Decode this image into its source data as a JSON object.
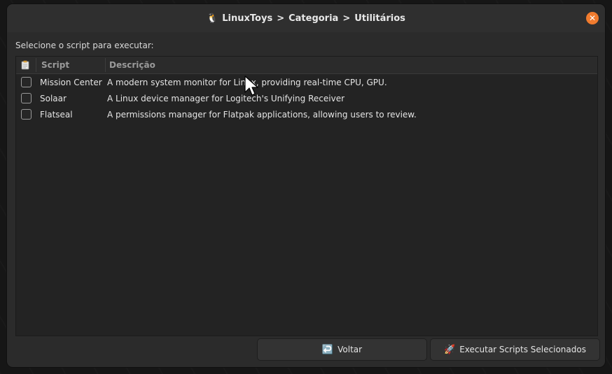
{
  "window": {
    "title_icon": "penguin-icon",
    "title_parts": [
      "LinuxToys",
      ">",
      "Categoria",
      ">",
      "Utilitários"
    ],
    "close_icon": "close-icon",
    "close_color": "#f07b2e"
  },
  "prompt": "Selecione o script para executar:",
  "table": {
    "header_icon": "clipboard-icon",
    "columns": [
      "Script",
      "Descrição"
    ],
    "rows": [
      {
        "checked": false,
        "name": "Mission Center",
        "description": "A modern system monitor for Linux, providing real-time CPU, GPU."
      },
      {
        "checked": false,
        "name": "Solaar",
        "description": "A Linux device manager for Logitech's Unifying Receiver"
      },
      {
        "checked": false,
        "name": "Flatseal",
        "description": "A permissions manager for Flatpak applications, allowing users to review."
      }
    ]
  },
  "buttons": {
    "back": {
      "icon": "return-arrow-icon",
      "label": "Voltar"
    },
    "run": {
      "icon": "rocket-icon",
      "label": "Executar Scripts Selecionados"
    }
  }
}
